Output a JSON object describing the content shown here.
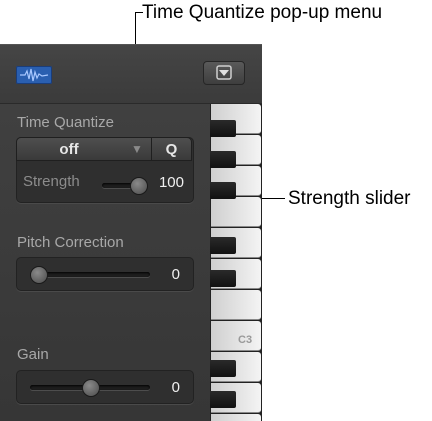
{
  "callouts": {
    "time_quantize_menu": "Time Quantize pop-up menu",
    "strength_slider": "Strength slider"
  },
  "inspector": {
    "time_quantize": {
      "label": "Time Quantize",
      "value": "off",
      "q_button": "Q",
      "strength_label": "Strength",
      "strength_value": "100"
    },
    "pitch_correction": {
      "label": "Pitch Correction",
      "value": "0"
    },
    "gain": {
      "label": "Gain",
      "value": "0"
    }
  },
  "keyboard": {
    "c3_label": "C3"
  },
  "colors": {
    "panel_bg": "#3a3a3a",
    "region_icon": "#2a5fb0"
  }
}
